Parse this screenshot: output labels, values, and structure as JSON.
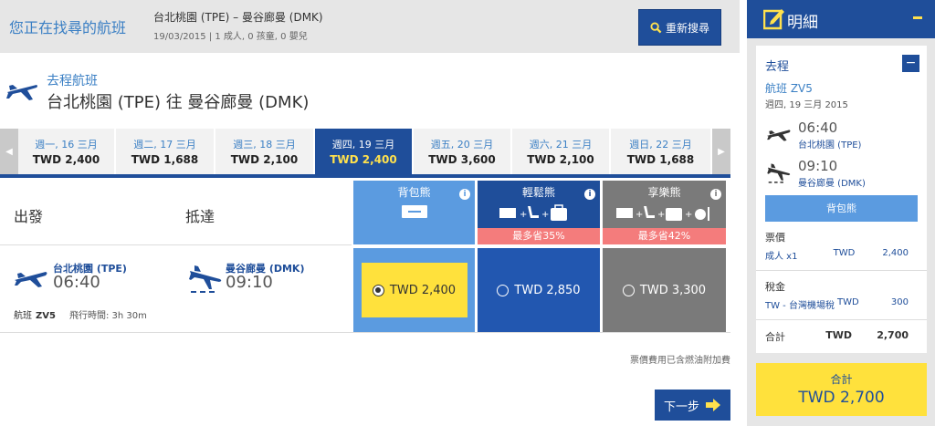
{
  "header": {
    "title": "您正在找尋的航班",
    "route": "台北桃園 (TPE) – 曼谷廊曼 (DMK)",
    "sub": "19/03/2015 | 1 成人, 0 孩童, 0 嬰兒",
    "search_again": "重新搜尋"
  },
  "outbound": {
    "label": "去程航班",
    "route": "台北桃園 (TPE) 往 曼谷廊曼 (DMK)"
  },
  "date_tabs": [
    {
      "day": "週一, 16 三月",
      "price": "TWD 2,400",
      "selected": false
    },
    {
      "day": "週二, 17 三月",
      "price": "TWD 1,688",
      "selected": false
    },
    {
      "day": "週三, 18 三月",
      "price": "TWD 2,100",
      "selected": false
    },
    {
      "day": "週四, 19 三月",
      "price": "TWD 2,400",
      "selected": true
    },
    {
      "day": "週五, 20 三月",
      "price": "TWD 3,600",
      "selected": false
    },
    {
      "day": "週六, 21 三月",
      "price": "TWD 2,100",
      "selected": false
    },
    {
      "day": "週日, 22 三月",
      "price": "TWD 1,688",
      "selected": false
    }
  ],
  "columns": {
    "depart": "出發",
    "arrive": "抵達"
  },
  "fares": [
    {
      "name": "背包熊",
      "save": "",
      "price": "TWD 2,400",
      "color": "#5b9be0",
      "cell_color": "#5b9be0"
    },
    {
      "name": "輕鬆熊",
      "save": "最多省35%",
      "price": "TWD 2,850",
      "color": "#1f4e9a",
      "cell_color": "#2257b0"
    },
    {
      "name": "享樂熊",
      "save": "最多省42%",
      "price": "TWD 3,300",
      "color": "#7a7a7a",
      "cell_color": "#7a7a7a"
    }
  ],
  "flight": {
    "dep_code": "台北桃園 (TPE)",
    "dep_time": "06:40",
    "arr_code": "曼谷廊曼 (DMK)",
    "arr_time": "09:10",
    "flight_label": "航班",
    "flight_no": "ZV5",
    "duration": "飛行時間: 3h 30m"
  },
  "fuel_note": "票價費用已含燃油附加費",
  "next": "下一步",
  "summary": {
    "title": "明細",
    "outbound": "去程",
    "flight": "航班 ZV5",
    "date": "週四, 19 三月 2015",
    "dep_time": "06:40",
    "dep_airport": "台北桃園 (TPE)",
    "arr_time": "09:10",
    "arr_airport": "曼谷廊曼 (DMK)",
    "fare_type": "背包熊",
    "fare_label": "票價",
    "adult": "成人 x1",
    "adult_cur": "TWD",
    "adult_amount": "2,400",
    "tax_label": "稅金",
    "tax": "TW - 台灣機場稅",
    "tax_cur": "TWD",
    "tax_amount": "300",
    "total_label": "合計",
    "total_cur": "TWD",
    "total_amount": "2,700",
    "grand_label": "合計",
    "grand_total": "TWD 2,700"
  }
}
